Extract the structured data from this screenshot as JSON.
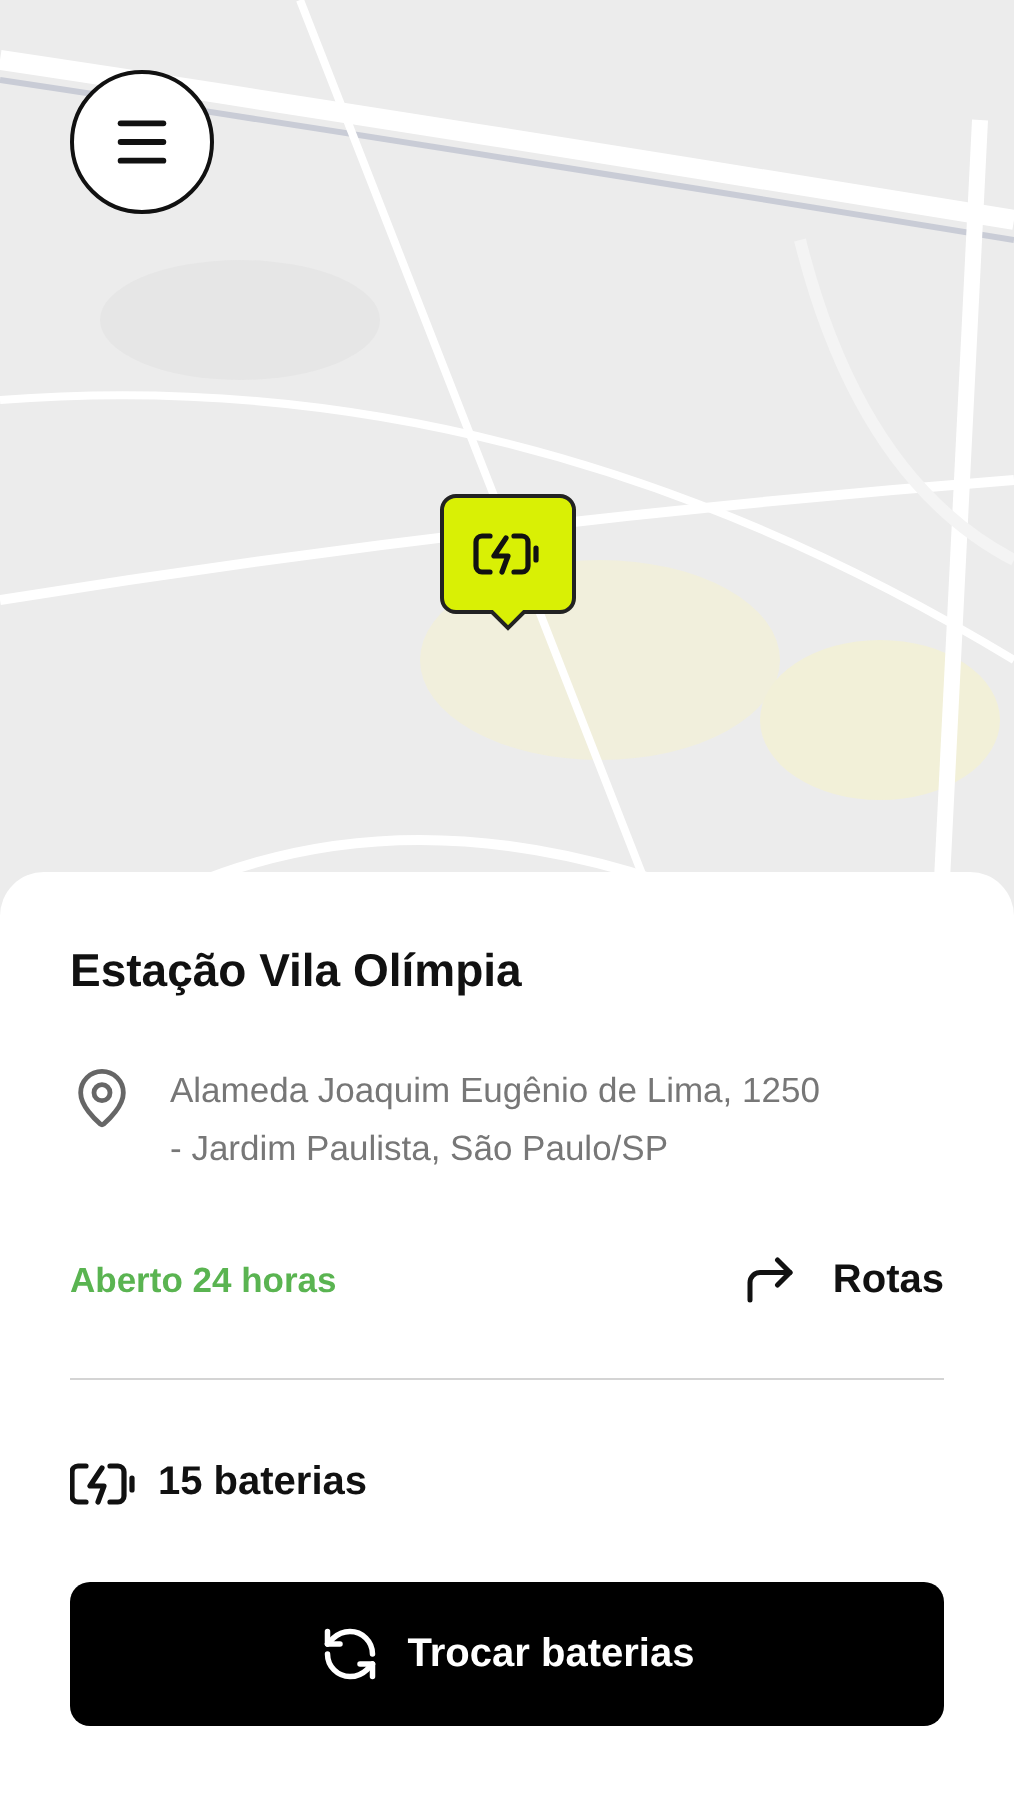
{
  "station": {
    "name": "Estação Vila Olímpia",
    "address": "Alameda Joaquim Eugênio de Lima, 1250 - Jardim Paulista, São Paulo/SP",
    "hours": "Aberto 24 horas",
    "directions": "Rotas",
    "batteries": "15 baterias"
  },
  "action": {
    "label": "Trocar baterias"
  }
}
